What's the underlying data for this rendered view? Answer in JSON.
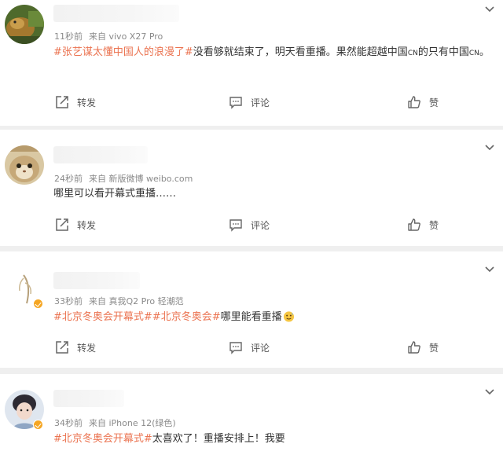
{
  "comments": [
    {
      "time": "11秒前",
      "source": "来自 vivo X27 Pro",
      "content": [
        {
          "type": "tag",
          "text": "#张艺谋太懂中国人的浪漫了#"
        },
        {
          "type": "text",
          "text": "没看够就结束了，明天看重播。果然能超越中国"
        },
        {
          "type": "small",
          "text": "CN"
        },
        {
          "type": "text",
          "text": "的只有中国"
        },
        {
          "type": "small",
          "text": "CN"
        },
        {
          "type": "text",
          "text": "。"
        }
      ],
      "forward_label": "转发",
      "comment_label": "评论",
      "like_label": "赞"
    },
    {
      "time": "24秒前",
      "source": "来自 新版微博 weibo.com",
      "content": [
        {
          "type": "text",
          "text": "哪里可以看开幕式重播……"
        }
      ],
      "forward_label": "转发",
      "comment_label": "评论",
      "like_label": "赞"
    },
    {
      "time": "33秒前",
      "source": "来自 真我Q2 Pro 轻潮范",
      "content": [
        {
          "type": "tag",
          "text": "#北京冬奥会开幕式#"
        },
        {
          "type": "tag",
          "text": "#北京冬奥会#"
        },
        {
          "type": "text",
          "text": "哪里能看重播"
        },
        {
          "type": "emoji",
          "icon": "sweat-smile-emoji"
        }
      ],
      "forward_label": "转发",
      "comment_label": "评论",
      "like_label": "赞"
    },
    {
      "time": "34秒前",
      "source": "来自 iPhone 12(绿色)",
      "content": [
        {
          "type": "tag",
          "text": "#北京冬奥会开幕式#"
        },
        {
          "type": "text",
          "text": "太喜欢了！重播安排上！我要"
        }
      ]
    }
  ],
  "colors": {
    "topic": "#eb7350",
    "meta": "#8a8a8a",
    "badge": "#f5a623",
    "separator": "#efefef"
  },
  "icons": {
    "forward": "share-arrow-icon",
    "comment": "comment-bubble-icon",
    "like": "thumbs-up-icon",
    "menu": "chevron-down-icon",
    "verified": "verified-badge-icon"
  }
}
